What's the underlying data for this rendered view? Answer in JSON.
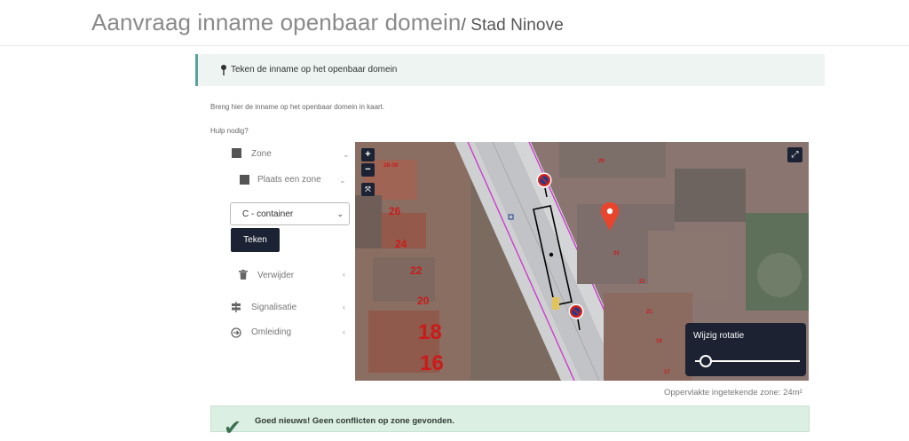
{
  "header": {
    "title": "Aanvraag inname openbaar domein",
    "subtitle": "/ Stad Ninove"
  },
  "step": {
    "label": "Teken de inname op het openbaar domein"
  },
  "intro_text": "Breng hier de inname op het openbaar domein in kaart.",
  "help_text": "Hulp nodig?",
  "menu": {
    "zone": "Zone",
    "place_zone": "Plaats een zone",
    "select_value": "C - container",
    "draw_button": "Teken",
    "delete": "Verwijder",
    "signalisation": "Signalisatie",
    "detour": "Omleiding"
  },
  "map": {
    "zoom_in": "+",
    "zoom_out": "−",
    "rotation_label": "Wijzig rotatie",
    "rotation_fraction": 0.05,
    "house_numbers": [
      "28-30",
      "26",
      "24",
      "22",
      "20",
      "18",
      "16",
      "29",
      "25",
      "23",
      "21",
      "19",
      "17"
    ],
    "container_label": "C"
  },
  "area_text": "Oppervlakte ingetekende zone: 24m²",
  "success_text": "Goed nieuws! Geen conflicten op zone gevonden.",
  "colors": {
    "primary": "#1b2233",
    "accent": "#5aa39b",
    "marker": "#e8452c",
    "success_bg": "#dcefe3"
  }
}
